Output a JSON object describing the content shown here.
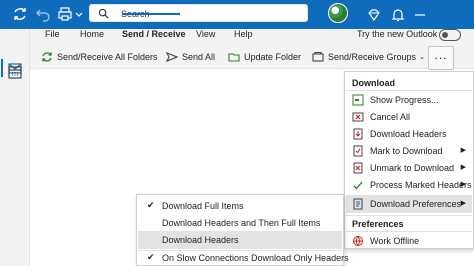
{
  "titlebar": {
    "search_placeholder": "Search",
    "try_new_outlook": "Try the new Outlook"
  },
  "tabs": [
    "File",
    "Home",
    "Send / Receive",
    "View",
    "Help"
  ],
  "ribbon": {
    "send_receive_all": "Send/Receive All Folders",
    "send_all": "Send All",
    "update_folder": "Update Folder",
    "send_receive_groups": "Send/Receive Groups",
    "more": "..."
  },
  "menu": {
    "download_header": "Download",
    "show_progress": "Show Progress...",
    "cancel_all": "Cancel All",
    "download_headers": "Download Headers",
    "mark_to_download": "Mark to Download",
    "unmark_to_download": "Unmark to Download",
    "process_marked_headers": "Process Marked Headers",
    "download_preferences": "Download Preferences",
    "preferences_header": "Preferences",
    "work_offline": "Work Offline"
  },
  "submenu": {
    "download_full_items": "Download Full Items",
    "download_headers_then_full": "Download Headers and Then Full Items",
    "download_headers": "Download Headers",
    "slow_connections": "On Slow Connections Download Only Headers"
  },
  "colors": {
    "accent": "#0f6cbd",
    "ribbon_bg": "#f3f3f3",
    "highlight": "#e3e3e3"
  }
}
